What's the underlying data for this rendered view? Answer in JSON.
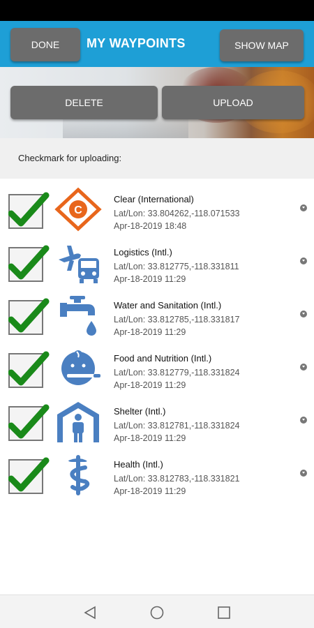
{
  "header": {
    "title": "MY WAYPOINTS",
    "done_label": "DONE",
    "show_map_label": "SHOW MAP",
    "accent_color": "#1e9fd6"
  },
  "actions": {
    "delete_label": "DELETE",
    "upload_label": "UPLOAD"
  },
  "instruction": "Checkmark for uploading:",
  "waypoints": [
    {
      "name": "Clear (International)",
      "coords": "Lat/Lon: 33.804262,-118.071533",
      "date": "Apr-18-2019 18:48",
      "icon": "clear-diamond-icon",
      "checked": true
    },
    {
      "name": "Logistics (Intl.)",
      "coords": "Lat/Lon: 33.812775,-118.331811",
      "date": "Apr-18-2019 11:29",
      "icon": "logistics-icon",
      "checked": true
    },
    {
      "name": "Water and Sanitation (Intl.)",
      "coords": "Lat/Lon: 33.812785,-118.331817",
      "date": "Apr-18-2019 11:29",
      "icon": "water-tap-icon",
      "checked": true
    },
    {
      "name": "Food and Nutrition (Intl.)",
      "coords": "Lat/Lon: 33.812779,-118.331824",
      "date": "Apr-18-2019 11:29",
      "icon": "food-nutrition-icon",
      "checked": true
    },
    {
      "name": "Shelter (Intl.)",
      "coords": "Lat/Lon: 33.812781,-118.331824",
      "date": "Apr-18-2019 11:29",
      "icon": "shelter-icon",
      "checked": true
    },
    {
      "name": "Health (Intl.)",
      "coords": "Lat/Lon: 33.812783,-118.331821",
      "date": "Apr-18-2019 11:29",
      "icon": "health-icon",
      "checked": true
    }
  ],
  "nav": {
    "back_icon": "back-triangle-icon",
    "home_icon": "home-circle-icon",
    "recents_icon": "recents-square-icon"
  }
}
